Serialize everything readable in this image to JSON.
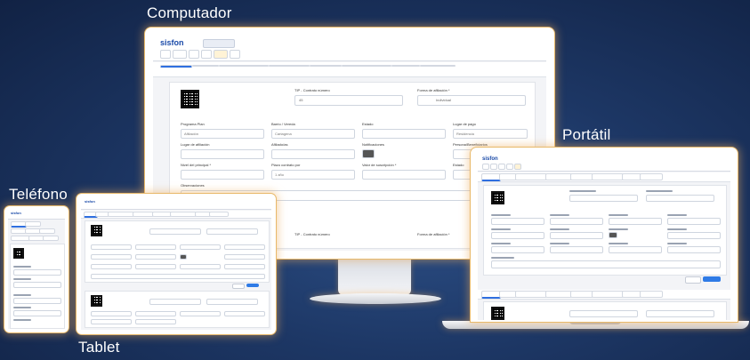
{
  "labels": {
    "desktop": "Computador",
    "laptop": "Portátil",
    "phone": "Teléfono",
    "tablet": "Tablet"
  },
  "app": {
    "brand": "sisfon"
  },
  "desktop": {
    "fields_row1": [
      {
        "label": "TIP - Contrato número",
        "value": "45"
      },
      {
        "label": "Forma de afiliación *",
        "value": "Individual"
      }
    ],
    "fields_row2": [
      {
        "label": "Programa Plan",
        "value": "Afiliación"
      },
      {
        "label": "Barrio / Vereda",
        "value": "Cartagena"
      },
      {
        "label": "Estado",
        "value": ""
      },
      {
        "label": "Lugar de pago",
        "value": "Residencia"
      }
    ],
    "fields_row3": [
      {
        "label": "Lugar de afiliación",
        "value": ""
      },
      {
        "label": "Afiliado/as",
        "value": ""
      },
      {
        "label": "Notificaciones",
        "value": ""
      },
      {
        "label": "Persona/Beneficiarios",
        "value": ""
      }
    ],
    "fields_row4": [
      {
        "label": "Nivel del principal *",
        "value": ""
      },
      {
        "label": "Plazo contrato por",
        "value": "1 año"
      },
      {
        "label": "Valor de suscripción *",
        "value": ""
      },
      {
        "label": "Estado",
        "value": ""
      }
    ],
    "observaciones": "Observaciones",
    "bottom_fields": [
      {
        "label": "TIP - Contrato número"
      },
      {
        "label": "Forma de afiliación *"
      }
    ]
  },
  "colors": {
    "glow": "#e8b96a",
    "primary": "#2f7be6",
    "brand": "#1a4aa8",
    "background": "#1d3765"
  }
}
